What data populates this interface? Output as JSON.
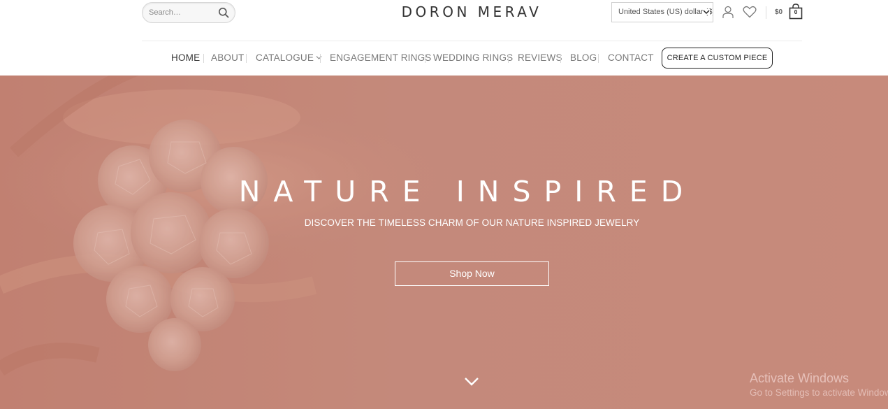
{
  "header": {
    "search": {
      "placeholder": "Search…"
    },
    "logo": "DORON MERAV",
    "currency": {
      "selected": "United States (US) dollar ($)"
    },
    "cart": {
      "total": "$0",
      "count": "0"
    },
    "icons": [
      "search-icon",
      "account-icon",
      "heart-icon",
      "cart-icon",
      "chevron-down-icon"
    ]
  },
  "nav": {
    "items": [
      {
        "label": "HOME",
        "active": true
      },
      {
        "label": "ABOUT"
      },
      {
        "label": "CATALOGUE",
        "has_dropdown": true
      },
      {
        "label": "ENGAGEMENT RINGS"
      },
      {
        "label": "WEDDING RINGS"
      },
      {
        "label": "REVIEWS"
      },
      {
        "label": "BLOG"
      },
      {
        "label": "CONTACT"
      }
    ],
    "cta_label": "CREATE A CUSTOM PIECE"
  },
  "hero": {
    "title": "NATURE INSPIRED",
    "subtitle": "DISCOVER THE TIMELESS CHARM OF OUR NATURE INSPIRED JEWELRY",
    "button_label": "Shop Now",
    "overlay_color": "#c6897a"
  },
  "os_watermark": {
    "title": "Activate Windows",
    "subtitle": "Go to Settings to activate Windows."
  }
}
